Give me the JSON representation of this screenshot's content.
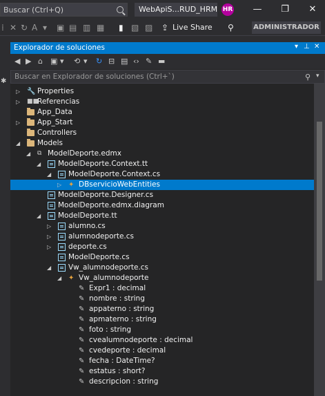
{
  "titlebar": {
    "quick_launch_placeholder": "Buscar (Ctrl+Q)",
    "document_title": "WebApiS...RUD_HRM",
    "avatar_initials": "HR",
    "minimize": "—",
    "restore": "❐",
    "close": "✕"
  },
  "toolbar": {
    "live_share_label": "Live Share",
    "admin_label": "ADMINISTRADOR"
  },
  "panel": {
    "title": "Explorador de soluciones",
    "search_placeholder": "Buscar en Explorador de soluciones (Ctrl+`)"
  },
  "tree": [
    {
      "label": "Properties",
      "icon": "wrench-icon",
      "depth": 1,
      "chevron": "right"
    },
    {
      "label": "Referencias",
      "icon": "references-icon",
      "depth": 1,
      "chevron": "right"
    },
    {
      "label": "App_Data",
      "icon": "folder-icon",
      "depth": 1,
      "chevron": "none"
    },
    {
      "label": "App_Start",
      "icon": "folder-icon",
      "depth": 1,
      "chevron": "right"
    },
    {
      "label": "Controllers",
      "icon": "folder-icon",
      "depth": 1,
      "chevron": "none"
    },
    {
      "label": "Models",
      "icon": "folder-icon",
      "depth": 1,
      "chevron": "down"
    },
    {
      "label": "ModelDeporte.edmx",
      "icon": "edmx-icon",
      "depth": 2,
      "chevron": "down"
    },
    {
      "label": "ModelDeporte.Context.tt",
      "icon": "file-icon",
      "depth": 3,
      "chevron": "down"
    },
    {
      "label": "ModelDeporte.Context.cs",
      "icon": "file-icon",
      "depth": 4,
      "chevron": "down"
    },
    {
      "label": "DBservicioWebEntities",
      "icon": "class-icon",
      "depth": 5,
      "chevron": "right",
      "selected": true
    },
    {
      "label": "ModelDeporte.Designer.cs",
      "icon": "file-icon",
      "depth": 3,
      "chevron": "none"
    },
    {
      "label": "ModelDeporte.edmx.diagram",
      "icon": "file-icon",
      "depth": 3,
      "chevron": "none"
    },
    {
      "label": "ModelDeporte.tt",
      "icon": "file-icon",
      "depth": 3,
      "chevron": "down"
    },
    {
      "label": "alumno.cs",
      "icon": "file-icon",
      "depth": 4,
      "chevron": "right"
    },
    {
      "label": "alumnodeporte.cs",
      "icon": "file-icon",
      "depth": 4,
      "chevron": "right"
    },
    {
      "label": "deporte.cs",
      "icon": "file-icon",
      "depth": 4,
      "chevron": "right"
    },
    {
      "label": "ModelDeporte.cs",
      "icon": "file-icon",
      "depth": 4,
      "chevron": "none"
    },
    {
      "label": "Vw_alumnodeporte.cs",
      "icon": "file-icon",
      "depth": 4,
      "chevron": "down"
    },
    {
      "label": "Vw_alumnodeporte",
      "icon": "class-icon",
      "depth": 5,
      "chevron": "down"
    },
    {
      "label": "Expr1 : decimal",
      "icon": "property-icon",
      "depth": 6,
      "chevron": "none"
    },
    {
      "label": "nombre : string",
      "icon": "property-icon",
      "depth": 6,
      "chevron": "none"
    },
    {
      "label": "appaterno : string",
      "icon": "property-icon",
      "depth": 6,
      "chevron": "none"
    },
    {
      "label": "apmaterno : string",
      "icon": "property-icon",
      "depth": 6,
      "chevron": "none"
    },
    {
      "label": "foto : string",
      "icon": "property-icon",
      "depth": 6,
      "chevron": "none"
    },
    {
      "label": "cvealumnodeporte : decimal",
      "icon": "property-icon",
      "depth": 6,
      "chevron": "none"
    },
    {
      "label": "cvedeporte : decimal",
      "icon": "property-icon",
      "depth": 6,
      "chevron": "none"
    },
    {
      "label": "fecha : DateTime?",
      "icon": "property-icon",
      "depth": 6,
      "chevron": "none"
    },
    {
      "label": "estatus : short?",
      "icon": "property-icon",
      "depth": 6,
      "chevron": "none"
    },
    {
      "label": "descripcion : string",
      "icon": "property-icon",
      "depth": 6,
      "chevron": "none"
    }
  ],
  "colors": {
    "accent": "#007acc",
    "background": "#252526",
    "folder": "#dcb67a",
    "class": "#e8a33d"
  }
}
